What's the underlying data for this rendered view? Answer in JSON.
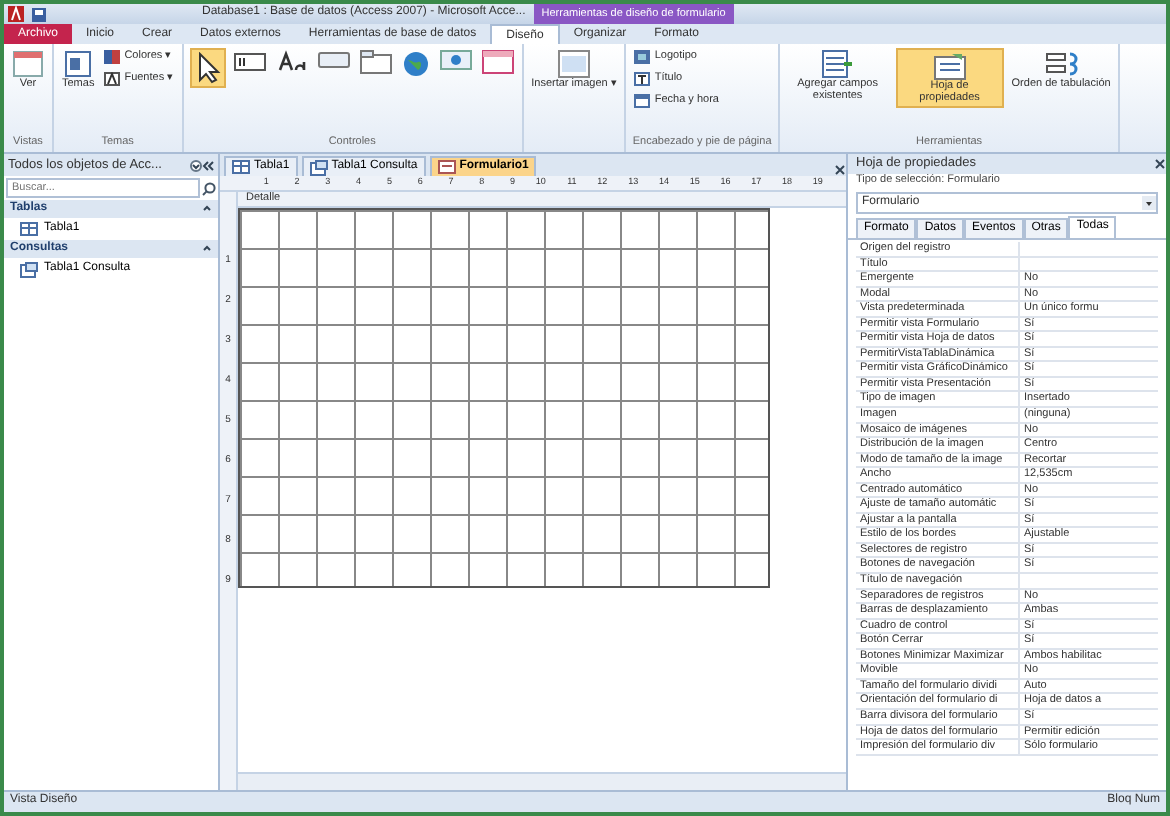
{
  "window": {
    "title": "Database1 : Base de datos (Access 2007) - Microsoft Acce...",
    "context_title": "Herramientas de diseño de formulario"
  },
  "ribbon_tabs": [
    {
      "label": "Archivo",
      "kind": "file",
      "selected": false
    },
    {
      "label": "Inicio",
      "kind": "tab",
      "selected": false
    },
    {
      "label": "Crear",
      "kind": "tab",
      "selected": false
    },
    {
      "label": "Datos externos",
      "kind": "tab",
      "selected": false
    },
    {
      "label": "Herramientas de base de datos",
      "kind": "tab",
      "selected": false
    },
    {
      "label": "Diseño",
      "kind": "tab",
      "selected": true
    },
    {
      "label": "Organizar",
      "kind": "tab",
      "selected": false
    },
    {
      "label": "Formato",
      "kind": "tab",
      "selected": false
    }
  ],
  "ribbon_groups": [
    {
      "label": "Vistas",
      "buttons": [
        {
          "label": "Ver",
          "kind": "view",
          "selected": false
        }
      ]
    },
    {
      "label": "Temas",
      "buttons": [
        {
          "label": "Temas",
          "kind": "themes",
          "selected": false
        },
        {
          "label": "Colores ▾",
          "kind": "colors",
          "selected": false
        },
        {
          "label": "Fuentes ▾",
          "kind": "fonts",
          "selected": false
        }
      ]
    },
    {
      "label": "Controles",
      "buttons": [
        {
          "kind": "pointer",
          "selected": true
        },
        {
          "kind": "textbox",
          "selected": false
        },
        {
          "kind": "labelctl",
          "selected": false
        },
        {
          "kind": "buttonctl",
          "selected": false
        },
        {
          "kind": "tabctl",
          "selected": false
        },
        {
          "kind": "globe",
          "selected": false
        },
        {
          "kind": "navctl",
          "selected": false
        },
        {
          "kind": "frame",
          "selected": false
        }
      ]
    },
    {
      "buttons": [
        {
          "label": "Insertar imagen ▾",
          "kind": "image",
          "selected": false
        }
      ]
    },
    {
      "label": "Encabezado y pie de página",
      "buttons": [
        {
          "label": "Logotipo",
          "kind": "logo",
          "selected": false
        },
        {
          "label": "Título",
          "kind": "titlectl",
          "selected": false
        },
        {
          "label": "Fecha y hora",
          "kind": "date",
          "selected": false
        }
      ]
    },
    {
      "label": "Herramientas",
      "buttons": [
        {
          "label": "Agregar campos existentes",
          "kind": "fields",
          "selected": false
        },
        {
          "label": "Hoja de propiedades",
          "kind": "props",
          "selected": true
        },
        {
          "label": "Orden de tabulación",
          "kind": "taborder",
          "selected": false
        }
      ]
    }
  ],
  "nav_pane": {
    "title": "Todos los objetos de Acc...",
    "search": {
      "placeholder": "Buscar..."
    },
    "groups": [
      {
        "label": "Tablas",
        "items": [
          {
            "label": "Tabla1",
            "kind": "table"
          }
        ]
      },
      {
        "label": "Consultas",
        "items": [
          {
            "label": "Tabla1 Consulta",
            "kind": "query"
          }
        ]
      }
    ]
  },
  "doc_tabs": [
    {
      "label": "Tabla1",
      "kind": "table",
      "selected": false
    },
    {
      "label": "Tabla1 Consulta",
      "kind": "query",
      "selected": false
    },
    {
      "label": "Formulario1",
      "kind": "form",
      "selected": true
    }
  ],
  "ruler": [
    "1",
    "2",
    "3",
    "4",
    "5",
    "6",
    "7",
    "8",
    "9",
    "10",
    "11",
    "12",
    "13",
    "14",
    "15",
    "16",
    "17",
    "18",
    "19"
  ],
  "vruler": [
    "1",
    "2",
    "3",
    "4",
    "5",
    "6",
    "7",
    "8",
    "9"
  ],
  "section": "Detalle",
  "property_sheet": {
    "title": "Hoja de propiedades",
    "selection_type": "Tipo de selección: Formulario",
    "selector": "Formulario",
    "tabs": [
      {
        "label": "Formato",
        "selected": false
      },
      {
        "label": "Datos",
        "selected": false
      },
      {
        "label": "Eventos",
        "selected": false
      },
      {
        "label": "Otras",
        "selected": false
      },
      {
        "label": "Todas",
        "selected": true
      }
    ],
    "rows": [
      [
        "Origen del registro"
      ],
      [
        "Título"
      ],
      [
        "Emergente",
        "No"
      ],
      [
        "Modal",
        "No"
      ],
      [
        "Vista predeterminada",
        "Un único formu"
      ],
      [
        "Permitir vista Formulario",
        "Sí"
      ],
      [
        "Permitir vista Hoja de datos",
        "Sí"
      ],
      [
        "PermitirVistaTablaDinámica",
        "Sí"
      ],
      [
        "Permitir vista GráficoDinámico",
        "Sí"
      ],
      [
        "Permitir vista Presentación",
        "Sí"
      ],
      [
        "Tipo de imagen",
        "Insertado"
      ],
      [
        "Imagen",
        "(ninguna)"
      ],
      [
        "Mosaico de imágenes",
        "No"
      ],
      [
        "Distribución de la imagen",
        "Centro"
      ],
      [
        "Modo de tamaño de la image",
        "Recortar"
      ],
      [
        "Ancho",
        "12,535cm"
      ],
      [
        "Centrado automático",
        "No"
      ],
      [
        "Ajuste de tamaño automátic",
        "Sí"
      ],
      [
        "Ajustar a la pantalla",
        "Sí"
      ],
      [
        "Estilo de los bordes",
        "Ajustable"
      ],
      [
        "Selectores de registro",
        "Sí"
      ],
      [
        "Botones de navegación",
        "Sí"
      ],
      [
        "Título de navegación"
      ],
      [
        "Separadores de registros",
        "No"
      ],
      [
        "Barras de desplazamiento",
        "Ambas"
      ],
      [
        "Cuadro de control",
        "Sí"
      ],
      [
        "Botón Cerrar",
        "Sí"
      ],
      [
        "Botones Minimizar Maximizar",
        "Ambos habilitac"
      ],
      [
        "Movible",
        "No"
      ],
      [
        "Tamaño del formulario dividi",
        "Auto"
      ],
      [
        "Orientación del formulario di",
        "Hoja de datos a"
      ],
      [
        "Barra divisora del formulario",
        "Sí"
      ],
      [
        "Hoja de datos del formulario",
        "Permitir edición"
      ],
      [
        "Impresión del formulario div",
        "Sólo formulario"
      ]
    ]
  },
  "status_bar": {
    "left": "Vista Diseño",
    "right": "Bloq Num"
  }
}
